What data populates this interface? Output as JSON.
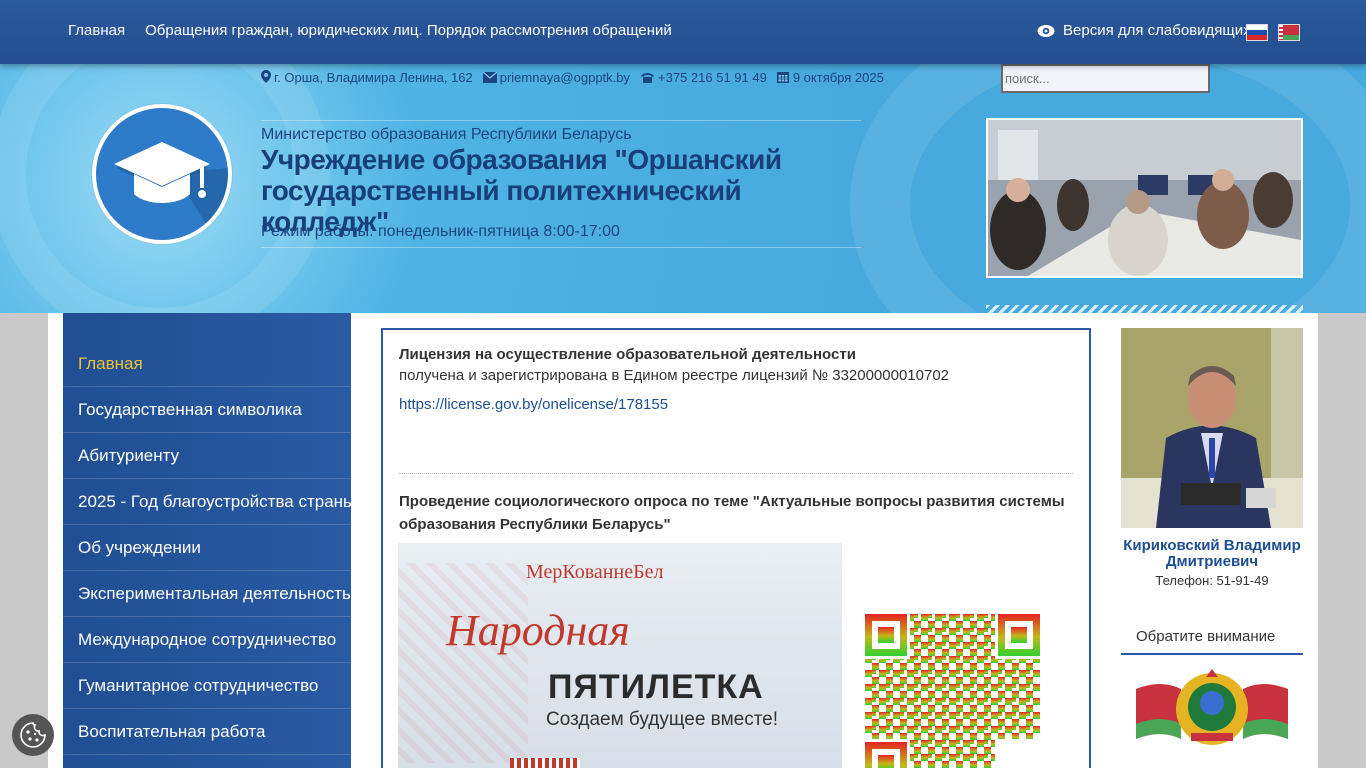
{
  "topnav": {
    "items": [
      "Главная",
      "Обращения граждан, юридических лиц. Порядок рассмотрения обращений"
    ],
    "vision_label": "Версия для слабовидящих"
  },
  "header": {
    "address": "г. Орша, Владимира Ленина, 162",
    "email": "priemnaya@ogpptk.by",
    "phone": "+375 216 51 91 49",
    "date": "9 октября 2025",
    "search_placeholder": "поиск...",
    "ministry": "Министерство образования Республики Беларусь",
    "org_name": "Учреждение образования \"Оршанский государственный политехнический колледж\"",
    "hours": "Режим работы: понедельник-пятница 8:00-17:00"
  },
  "sidebar": {
    "items": [
      {
        "label": "Главная",
        "active": true
      },
      {
        "label": "Государственная символика"
      },
      {
        "label": "Абитуриенту"
      },
      {
        "label": "2025 - Год благоустройства страны"
      },
      {
        "label": "Об учреждении"
      },
      {
        "label": "Экспериментальная деятельность"
      },
      {
        "label": "Международное сотрудничество"
      },
      {
        "label": "Гуманитарное сотрудничество"
      },
      {
        "label": "Воспитательная работа"
      }
    ]
  },
  "content": {
    "license_title": "Лицензия на осуществление образовательной деятельности",
    "license_text": "получена и зарегистрирована в Едином реестре лицензий № 33200000010702",
    "license_link": "https://license.gov.by/onelicense/178155",
    "survey_title": "Проведение социологического опроса по теме \"Актуальные вопросы развития системы образования Республики Беларусь\"",
    "banner": {
      "brand": "МерКованнеБел",
      "headline": "Народная",
      "headline2": "ПЯТИЛЕТКА",
      "slogan": "Создаем будущее вместе!"
    }
  },
  "right": {
    "person_name": "Кириковский Владимир Дмитриевич",
    "person_phone": "Телефон: 51-91-49",
    "attention_title": "Обратите внимание"
  },
  "colors": {
    "topbar": "#2c5aa0",
    "sidebar": "#1f4e93",
    "active_item": "#f1c232",
    "link": "#1f4e93"
  }
}
